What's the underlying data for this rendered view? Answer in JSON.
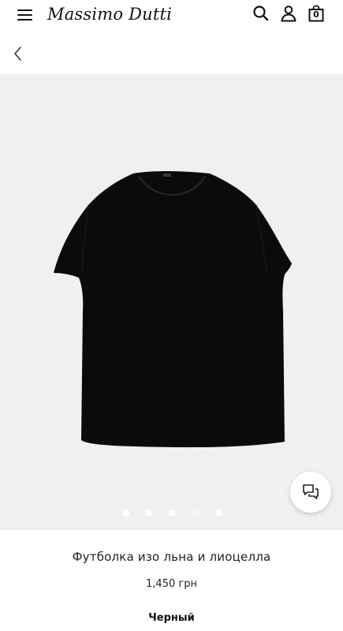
{
  "header": {
    "logo_text": "Massimo Dutti",
    "bag_count": "0",
    "icons": [
      "menu-icon",
      "search-icon",
      "user-icon",
      "shopping-bag-icon"
    ]
  },
  "navigation": {
    "back_icon": "chevron-left-icon"
  },
  "gallery": {
    "image_count": 5,
    "active_index": 3,
    "background_color": "#f0f0f0",
    "chat_icon": "chat-bubbles-icon"
  },
  "product": {
    "name": "Футболка изо льна и лиоцелла",
    "price": "1,450 грн",
    "color": "Черный",
    "garment_color": "#0b0b0b"
  }
}
